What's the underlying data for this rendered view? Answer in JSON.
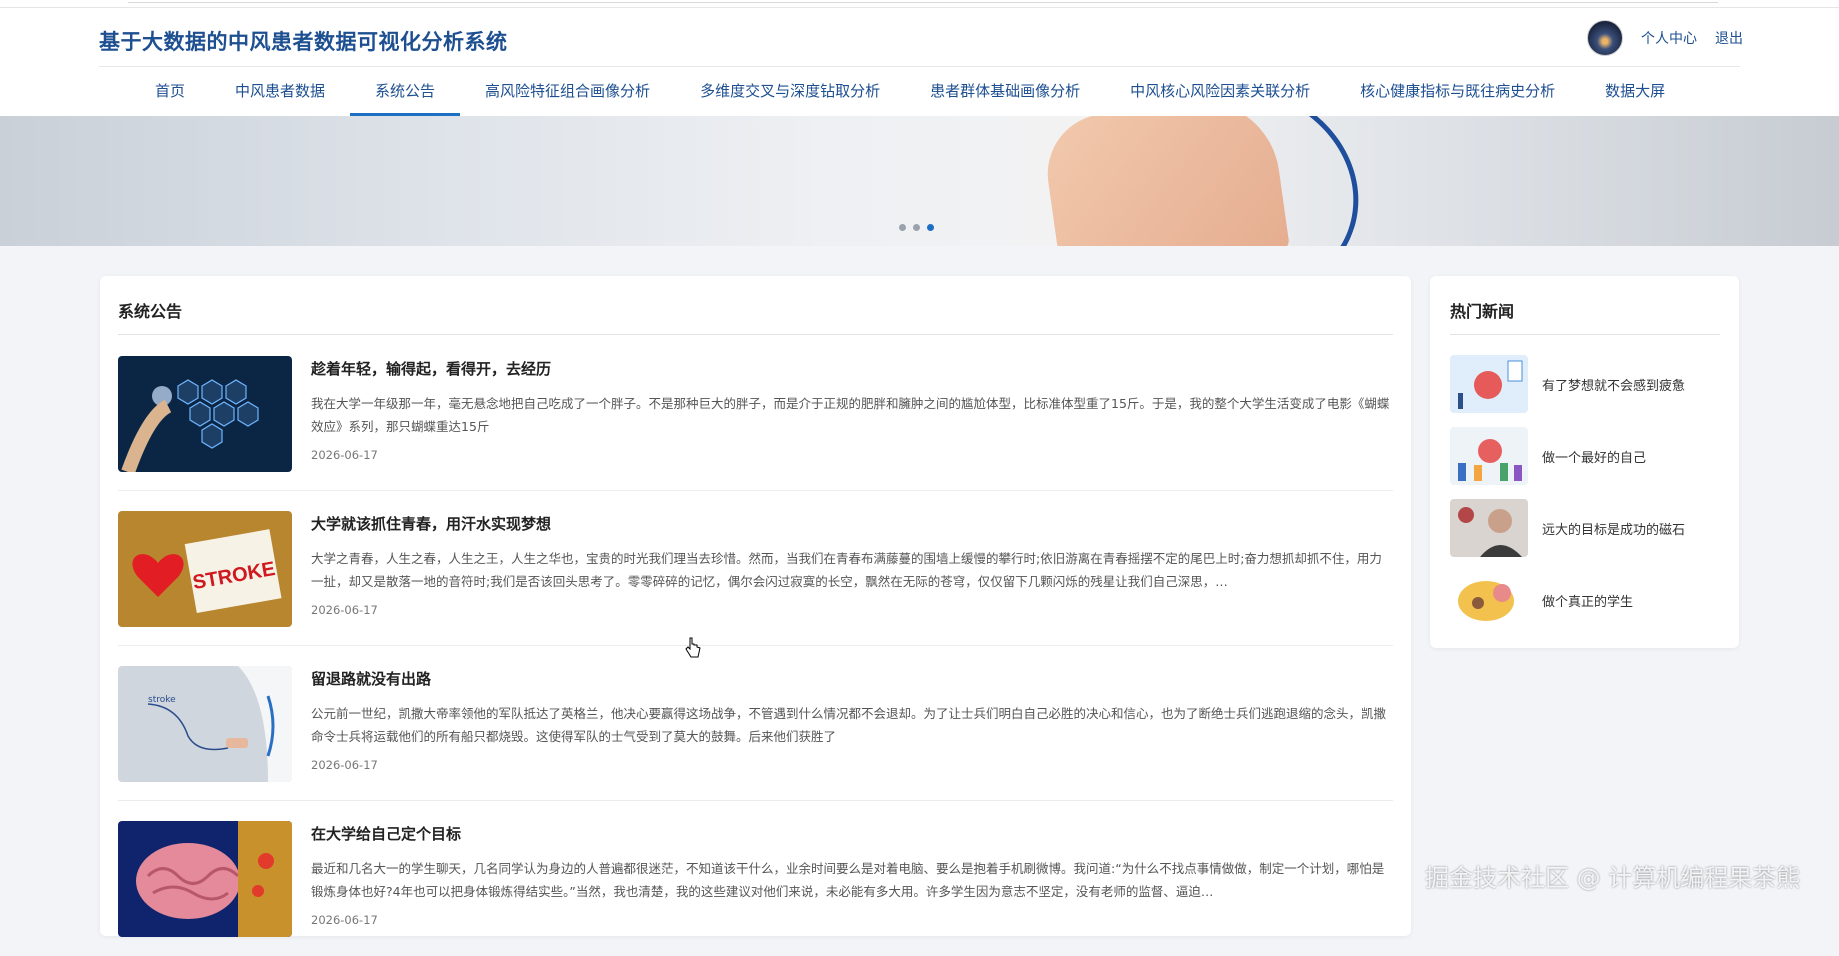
{
  "app": {
    "title": "基于大数据的中风患者数据可视化分析系统",
    "user_center": "个人中心",
    "logout": "退出"
  },
  "nav": {
    "tabs": [
      {
        "label": "首页",
        "active": false
      },
      {
        "label": "中风患者数据",
        "active": false
      },
      {
        "label": "系统公告",
        "active": true
      },
      {
        "label": "高风险特征组合画像分析",
        "active": false
      },
      {
        "label": "多维度交叉与深度钻取分析",
        "active": false
      },
      {
        "label": "患者群体基础画像分析",
        "active": false
      },
      {
        "label": "中风核心风险因素关联分析",
        "active": false
      },
      {
        "label": "核心健康指标与既往病史分析",
        "active": false
      },
      {
        "label": "数据大屏",
        "active": false
      }
    ]
  },
  "carousel": {
    "count": 3,
    "active_index": 2
  },
  "notices": {
    "title": "系统公告",
    "items": [
      {
        "title": "趁着年轻，输得起，看得开，去经历",
        "desc": "我在大学一年级那一年，毫无悬念地把自己吃成了一个胖子。不是那种巨大的胖子，而是介于正规的肥胖和臃肿之间的尴尬体型，比标准体型重了15斤。于是，我的整个大学生活变成了电影《蝴蝶效应》系列，那只蝴蝶重达15斤",
        "date": "2026-06-17",
        "thumb": "medical-hexagon-icons"
      },
      {
        "title": "大学就该抓住青春，用汗水实现梦想",
        "desc": "大学之青春，人生之春，人生之王，人生之华也，宝贵的时光我们理当去珍惜。然而，当我们在青春布满藤蔓的围墙上缓慢的攀行时;依旧游离在青春摇摆不定的尾巴上时;奋力想抓却抓不住，用力一扯，却又是散落一地的音符时;我们是否该回头思考了。零零碎碎的记忆，偶尔会闪过寂寞的长空，飘然在无际的苍穹，仅仅留下几颗闪烁的残星让我们自己深思，…",
        "date": "2026-06-17",
        "thumb": "stroke-note-heart"
      },
      {
        "title": "留退路就没有出路",
        "desc": "公元前一世纪，凯撒大帝率领他的军队抵达了英格兰，他决心要赢得这场战争，不管遇到什么情况都不会退却。为了让士兵们明白自己必胜的决心和信心，也为了断绝士兵们逃跑退缩的念头，凯撒命令士兵将运载他们的所有船只都烧毁。这使得军队的士气受到了莫大的鼓舞。后来他们获胜了",
        "date": "2026-06-17",
        "thumb": "doctor-writing-stroke"
      },
      {
        "title": "在大学给自己定个目标",
        "desc": "最近和几名大一的学生聊天，几名同学认为身边的人普遍都很迷茫，不知道该干什么，业余时间要么是对着电脑、要么是抱着手机刷微博。我问道:“为什么不找点事情做做，制定一个计划，哪怕是锻炼身体也好?4年也可以把身体锻炼得结实些。”当然，我也清楚，我的这些建议对他们来说，未必能有多大用。许多学生因为意志不坚定，没有老师的监督、逼迫…",
        "date": "2026-06-17",
        "thumb": "brain-blood-vessel"
      }
    ]
  },
  "hot_news": {
    "title": "热门新闻",
    "items": [
      {
        "label": "有了梦想就不会感到疲惫",
        "thumb": "brain-clipboard-illustration"
      },
      {
        "label": "做一个最好的自己",
        "thumb": "people-brain-illustration"
      },
      {
        "label": "远大的目标是成功的磁石",
        "thumb": "elderly-man-headache"
      },
      {
        "label": "做个真正的学生",
        "thumb": "brain-cartoon-illustration"
      }
    ]
  },
  "watermark": "掘金技术社区 @ 计算机编程果茶熊",
  "colors": {
    "brand": "#1d4f91",
    "accent": "#1d6fc4",
    "page_bg": "#f2f4f8"
  }
}
